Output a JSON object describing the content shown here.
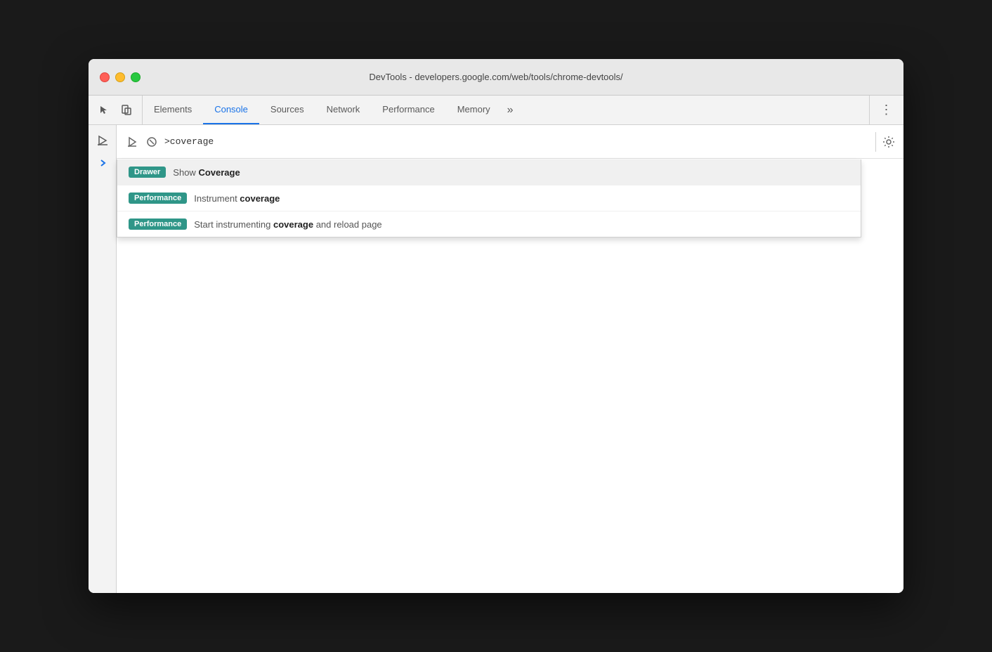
{
  "window": {
    "title": "DevTools - developers.google.com/web/tools/chrome-devtools/"
  },
  "tabs": [
    {
      "id": "elements",
      "label": "Elements",
      "active": false
    },
    {
      "id": "console",
      "label": "Console",
      "active": true
    },
    {
      "id": "sources",
      "label": "Sources",
      "active": false
    },
    {
      "id": "network",
      "label": "Network",
      "active": false
    },
    {
      "id": "performance",
      "label": "Performance",
      "active": false
    },
    {
      "id": "memory",
      "label": "Memory",
      "active": false
    }
  ],
  "console": {
    "input_value": ">coverage"
  },
  "autocomplete": {
    "items": [
      {
        "badge_type": "drawer",
        "badge_label": "Drawer",
        "text_prefix": "Show ",
        "text_bold": "Coverage",
        "text_suffix": ""
      },
      {
        "badge_type": "performance",
        "badge_label": "Performance",
        "text_prefix": "Instrument ",
        "text_bold": "coverage",
        "text_suffix": ""
      },
      {
        "badge_type": "performance",
        "badge_label": "Performance",
        "text_prefix": "Start instrumenting ",
        "text_bold": "coverage",
        "text_suffix": " and reload page"
      }
    ]
  }
}
